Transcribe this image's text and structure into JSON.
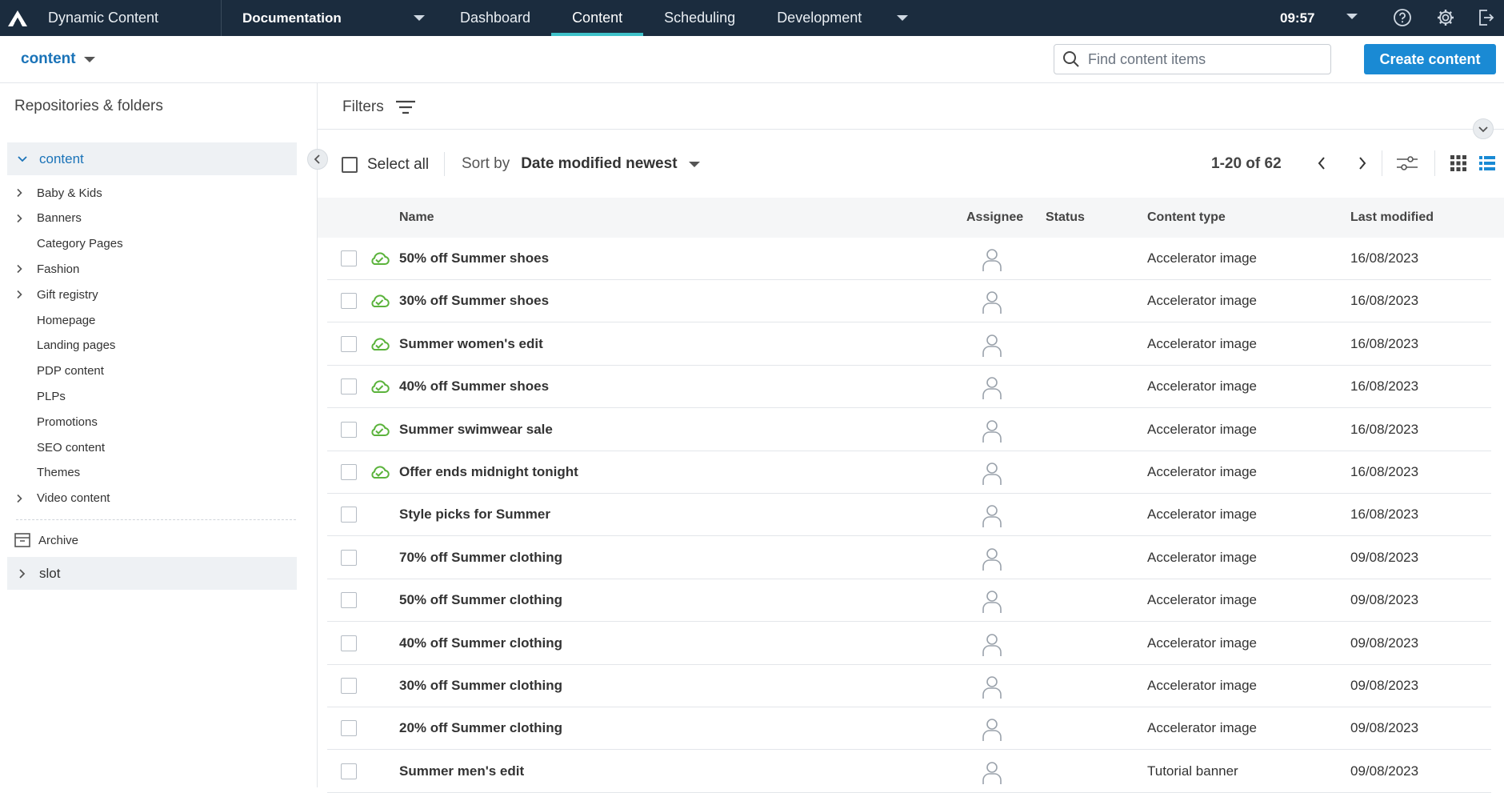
{
  "app": {
    "title": "Dynamic Content",
    "time": "09:57"
  },
  "nav": {
    "hub": "Documentation",
    "tabs": [
      {
        "label": "Dashboard"
      },
      {
        "label": "Content"
      },
      {
        "label": "Scheduling"
      },
      {
        "label": "Development"
      }
    ],
    "active_tab": "Content"
  },
  "subheader": {
    "repository": "content",
    "search_placeholder": "Find content items",
    "create_label": "Create content"
  },
  "sidebar": {
    "title": "Repositories & folders",
    "root": "content",
    "folders": [
      {
        "label": "Baby & Kids",
        "expandable": true
      },
      {
        "label": "Banners",
        "expandable": true
      },
      {
        "label": "Category Pages",
        "expandable": false
      },
      {
        "label": "Fashion",
        "expandable": true
      },
      {
        "label": "Gift registry",
        "expandable": true
      },
      {
        "label": "Homepage",
        "expandable": false
      },
      {
        "label": "Landing pages",
        "expandable": false
      },
      {
        "label": "PDP content",
        "expandable": false
      },
      {
        "label": "PLPs",
        "expandable": false
      },
      {
        "label": "Promotions",
        "expandable": false
      },
      {
        "label": "SEO content",
        "expandable": false
      },
      {
        "label": "Themes",
        "expandable": false
      },
      {
        "label": "Video content",
        "expandable": true
      }
    ],
    "archive": "Archive",
    "slot": "slot"
  },
  "filters": {
    "label": "Filters"
  },
  "toolbar": {
    "select_all": "Select all",
    "sort_label": "Sort by",
    "sort_value": "Date modified newest",
    "pagination": "1-20 of 62"
  },
  "table": {
    "columns": {
      "name": "Name",
      "assignee": "Assignee",
      "status": "Status",
      "content_type": "Content type",
      "last_modified": "Last modified"
    },
    "rows": [
      {
        "name": "50% off Summer shoes",
        "published": true,
        "content_type": "Accelerator image",
        "last_modified": "16/08/2023"
      },
      {
        "name": "30% off Summer shoes",
        "published": true,
        "content_type": "Accelerator image",
        "last_modified": "16/08/2023"
      },
      {
        "name": "Summer women's edit",
        "published": true,
        "content_type": "Accelerator image",
        "last_modified": "16/08/2023"
      },
      {
        "name": "40% off Summer shoes",
        "published": true,
        "content_type": "Accelerator image",
        "last_modified": "16/08/2023"
      },
      {
        "name": "Summer swimwear sale",
        "published": true,
        "content_type": "Accelerator image",
        "last_modified": "16/08/2023"
      },
      {
        "name": "Offer ends midnight tonight",
        "published": true,
        "content_type": "Accelerator image",
        "last_modified": "16/08/2023"
      },
      {
        "name": "Style picks for Summer",
        "published": false,
        "content_type": "Accelerator image",
        "last_modified": "16/08/2023"
      },
      {
        "name": "70% off Summer clothing",
        "published": false,
        "content_type": "Accelerator image",
        "last_modified": "09/08/2023"
      },
      {
        "name": "50% off Summer clothing",
        "published": false,
        "content_type": "Accelerator image",
        "last_modified": "09/08/2023"
      },
      {
        "name": "40% off Summer clothing",
        "published": false,
        "content_type": "Accelerator image",
        "last_modified": "09/08/2023"
      },
      {
        "name": "30% off Summer clothing",
        "published": false,
        "content_type": "Accelerator image",
        "last_modified": "09/08/2023"
      },
      {
        "name": "20% off Summer clothing",
        "published": false,
        "content_type": "Accelerator image",
        "last_modified": "09/08/2023"
      },
      {
        "name": "Summer men's edit",
        "published": false,
        "content_type": "Tutorial banner",
        "last_modified": "09/08/2023"
      }
    ]
  },
  "colors": {
    "nav_bg": "#1b2c3e",
    "accent": "#1a8ad4",
    "active_tab": "#3fc1c9",
    "published": "#5bb33c"
  },
  "icons": [
    "app-logo-icon",
    "caret-down-icon",
    "help-icon",
    "gear-icon",
    "logout-icon",
    "search-icon",
    "filter-icon",
    "chevron-left-icon",
    "chevron-right-icon",
    "chevron-down-icon",
    "column-settings-icon",
    "grid-view-icon",
    "list-view-icon",
    "archive-icon",
    "cloud-published-icon",
    "user-icon"
  ]
}
